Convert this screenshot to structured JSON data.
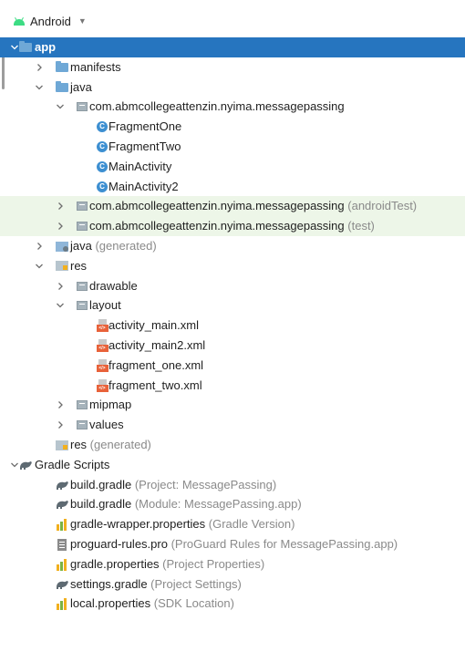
{
  "header": {
    "title": "Android",
    "dropdown_icon": "caret-down-icon"
  },
  "tree": [
    {
      "id": "app",
      "level": 0,
      "arrow": "down",
      "icon": "module-folder",
      "label": "app",
      "state": "selected"
    },
    {
      "id": "manifests",
      "level": 1,
      "arrow": "right",
      "icon": "folder-blue",
      "label": "manifests"
    },
    {
      "id": "java",
      "level": 1,
      "arrow": "down",
      "icon": "folder-blue",
      "label": "java"
    },
    {
      "id": "pkg-main",
      "level": 2,
      "arrow": "down",
      "icon": "package",
      "label": "com.abmcollegeattenzin.nyima.messagepassing"
    },
    {
      "id": "fragment-one",
      "level": 3,
      "icon": "class",
      "label": "FragmentOne"
    },
    {
      "id": "fragment-two",
      "level": 3,
      "icon": "class",
      "label": "FragmentTwo"
    },
    {
      "id": "main-activity",
      "level": 3,
      "icon": "class",
      "label": "MainActivity"
    },
    {
      "id": "main-activity2",
      "level": 3,
      "icon": "class",
      "label": "MainActivity2"
    },
    {
      "id": "pkg-androidtest",
      "level": 2,
      "arrow": "right",
      "icon": "package",
      "label": "com.abmcollegeattenzin.nyima.messagepassing",
      "secondary": "(androidTest)",
      "state": "highlight"
    },
    {
      "id": "pkg-test",
      "level": 2,
      "arrow": "right",
      "icon": "package",
      "label": "com.abmcollegeattenzin.nyima.messagepassing",
      "secondary": "(test)",
      "state": "highlight"
    },
    {
      "id": "java-generated",
      "level": 1,
      "arrow": "right",
      "icon": "generated-folder",
      "label": "java",
      "secondary": "(generated)"
    },
    {
      "id": "res",
      "level": 1,
      "arrow": "down",
      "icon": "res-folder",
      "label": "res"
    },
    {
      "id": "drawable",
      "level": 2,
      "arrow": "right",
      "icon": "package",
      "label": "drawable"
    },
    {
      "id": "layout",
      "level": 2,
      "arrow": "down",
      "icon": "package",
      "label": "layout"
    },
    {
      "id": "activity-main-xml",
      "level": 3,
      "icon": "xml",
      "label": "activity_main.xml"
    },
    {
      "id": "activity-main2-xml",
      "level": 3,
      "icon": "xml",
      "label": "activity_main2.xml"
    },
    {
      "id": "fragment-one-xml",
      "level": 3,
      "icon": "xml",
      "label": "fragment_one.xml"
    },
    {
      "id": "fragment-two-xml",
      "level": 3,
      "icon": "xml",
      "label": "fragment_two.xml"
    },
    {
      "id": "mipmap",
      "level": 2,
      "arrow": "right",
      "icon": "package",
      "label": "mipmap"
    },
    {
      "id": "values",
      "level": 2,
      "arrow": "right",
      "icon": "package",
      "label": "values"
    },
    {
      "id": "res-generated",
      "level": 1,
      "icon": "res-folder",
      "label": "res",
      "secondary": "(generated)"
    },
    {
      "id": "gradle-scripts",
      "level": 0,
      "arrow": "down",
      "icon": "gradle",
      "label": "Gradle Scripts"
    },
    {
      "id": "build-gradle-project",
      "level": 1,
      "icon": "gradle",
      "label": "build.gradle",
      "secondary": "(Project: MessagePassing)"
    },
    {
      "id": "build-gradle-module",
      "level": 1,
      "icon": "gradle",
      "label": "build.gradle",
      "secondary": "(Module: MessagePassing.app)"
    },
    {
      "id": "gradle-wrapper",
      "level": 1,
      "icon": "properties",
      "label": "gradle-wrapper.properties",
      "secondary": "(Gradle Version)"
    },
    {
      "id": "proguard",
      "level": 1,
      "icon": "text-file",
      "label": "proguard-rules.pro",
      "secondary": "(ProGuard Rules for MessagePassing.app)"
    },
    {
      "id": "gradle-properties",
      "level": 1,
      "icon": "properties",
      "label": "gradle.properties",
      "secondary": "(Project Properties)"
    },
    {
      "id": "settings-gradle",
      "level": 1,
      "icon": "gradle",
      "label": "settings.gradle",
      "secondary": "(Project Settings)"
    },
    {
      "id": "local-properties",
      "level": 1,
      "icon": "properties",
      "label": "local.properties",
      "secondary": "(SDK Location)"
    }
  ]
}
